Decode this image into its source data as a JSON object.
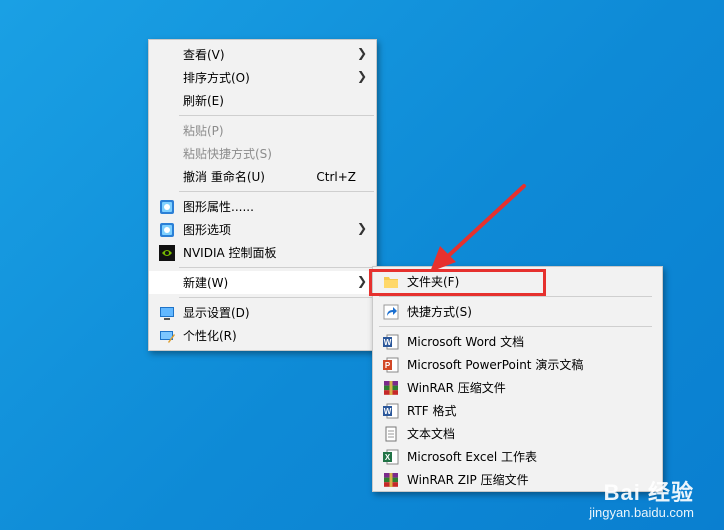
{
  "context_menu": {
    "items": [
      {
        "label": "查看(V)",
        "submenu": true
      },
      {
        "label": "排序方式(O)",
        "submenu": true
      },
      {
        "label": "刷新(E)"
      },
      {
        "label": "粘贴(P)",
        "disabled": true
      },
      {
        "label": "粘贴快捷方式(S)",
        "disabled": true
      },
      {
        "label": "撤消 重命名(U)",
        "shortcut": "Ctrl+Z"
      },
      {
        "label": "图形属性......",
        "icon": "intel-graphics-icon"
      },
      {
        "label": "图形选项",
        "icon": "intel-graphics-icon",
        "submenu": true
      },
      {
        "label": "NVIDIA 控制面板",
        "icon": "nvidia-icon"
      },
      {
        "label": "新建(W)",
        "submenu": true,
        "hover": true
      },
      {
        "label": "显示设置(D)",
        "icon": "display-icon"
      },
      {
        "label": "个性化(R)",
        "icon": "personalize-icon"
      }
    ]
  },
  "new_submenu": {
    "items": [
      {
        "label": "文件夹(F)",
        "icon": "folder-icon"
      },
      {
        "label": "快捷方式(S)",
        "icon": "shortcut-icon"
      },
      {
        "label": "Microsoft Word 文档",
        "icon": "word-icon"
      },
      {
        "label": "Microsoft PowerPoint 演示文稿",
        "icon": "powerpoint-icon"
      },
      {
        "label": "WinRAR 压缩文件",
        "icon": "winrar-icon"
      },
      {
        "label": "RTF 格式",
        "icon": "rtf-icon"
      },
      {
        "label": "文本文档",
        "icon": "text-doc-icon"
      },
      {
        "label": "Microsoft Excel 工作表",
        "icon": "excel-icon"
      },
      {
        "label": "WinRAR ZIP 压缩文件",
        "icon": "winrar-zip-icon"
      }
    ]
  },
  "watermark": {
    "brand": "Bai 经验",
    "url": "jingyan.baidu.com"
  },
  "colors": {
    "desktop": "#0e8ad6",
    "menu_bg": "#f2f2f2",
    "highlight": "#e6312e"
  }
}
